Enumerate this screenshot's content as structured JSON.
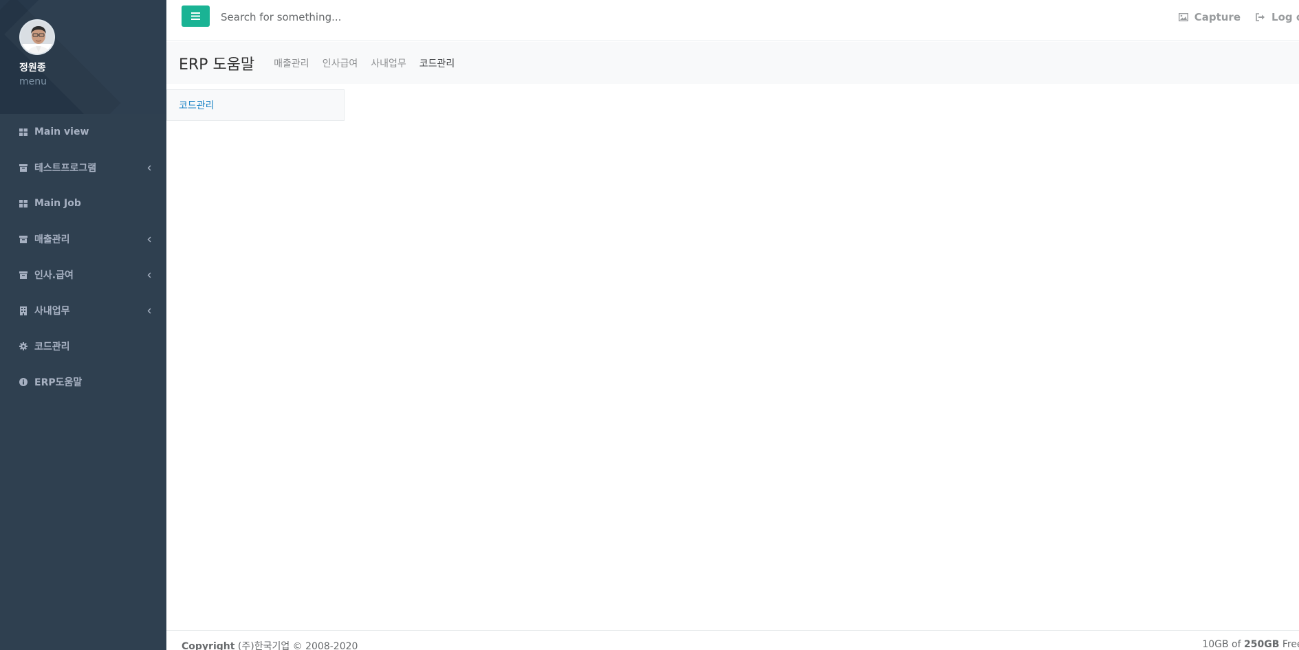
{
  "profile": {
    "name": "정원종",
    "role": "menu"
  },
  "sidebar": {
    "items": [
      {
        "label": "Main view",
        "icon": "dashboard-icon",
        "has_submenu": false
      },
      {
        "label": "테스트프로그램",
        "icon": "archive-icon",
        "has_submenu": true
      },
      {
        "label": "Main Job",
        "icon": "dashboard-icon",
        "has_submenu": false
      },
      {
        "label": "매출관리",
        "icon": "archive-icon",
        "has_submenu": true
      },
      {
        "label": "인사.급여",
        "icon": "archive-icon",
        "has_submenu": true
      },
      {
        "label": "사내업무",
        "icon": "building-icon",
        "has_submenu": true
      },
      {
        "label": "코드관리",
        "icon": "gear-icon",
        "has_submenu": false
      },
      {
        "label": "ERP도움말",
        "icon": "info-icon",
        "has_submenu": false
      }
    ]
  },
  "topbar": {
    "search_placeholder": "Search for something...",
    "capture_label": "Capture",
    "logout_label": "Log out"
  },
  "heading": {
    "title": "ERP 도움말",
    "breadcrumbs": [
      "매출관리",
      "인사급여",
      "사내업무",
      "코드관리"
    ]
  },
  "content": {
    "link_label": "코드관리"
  },
  "footer": {
    "copyright_bold": "Copyright",
    "copyright_text": " (주)한국기업 © 2008-2020",
    "storage_used": "10GB",
    "storage_of": " of ",
    "storage_total": "250GB",
    "storage_suffix": " Free."
  },
  "colors": {
    "sidebar_bg": "#2f4050",
    "accent": "#1ab394",
    "link": "#1c84c6"
  }
}
